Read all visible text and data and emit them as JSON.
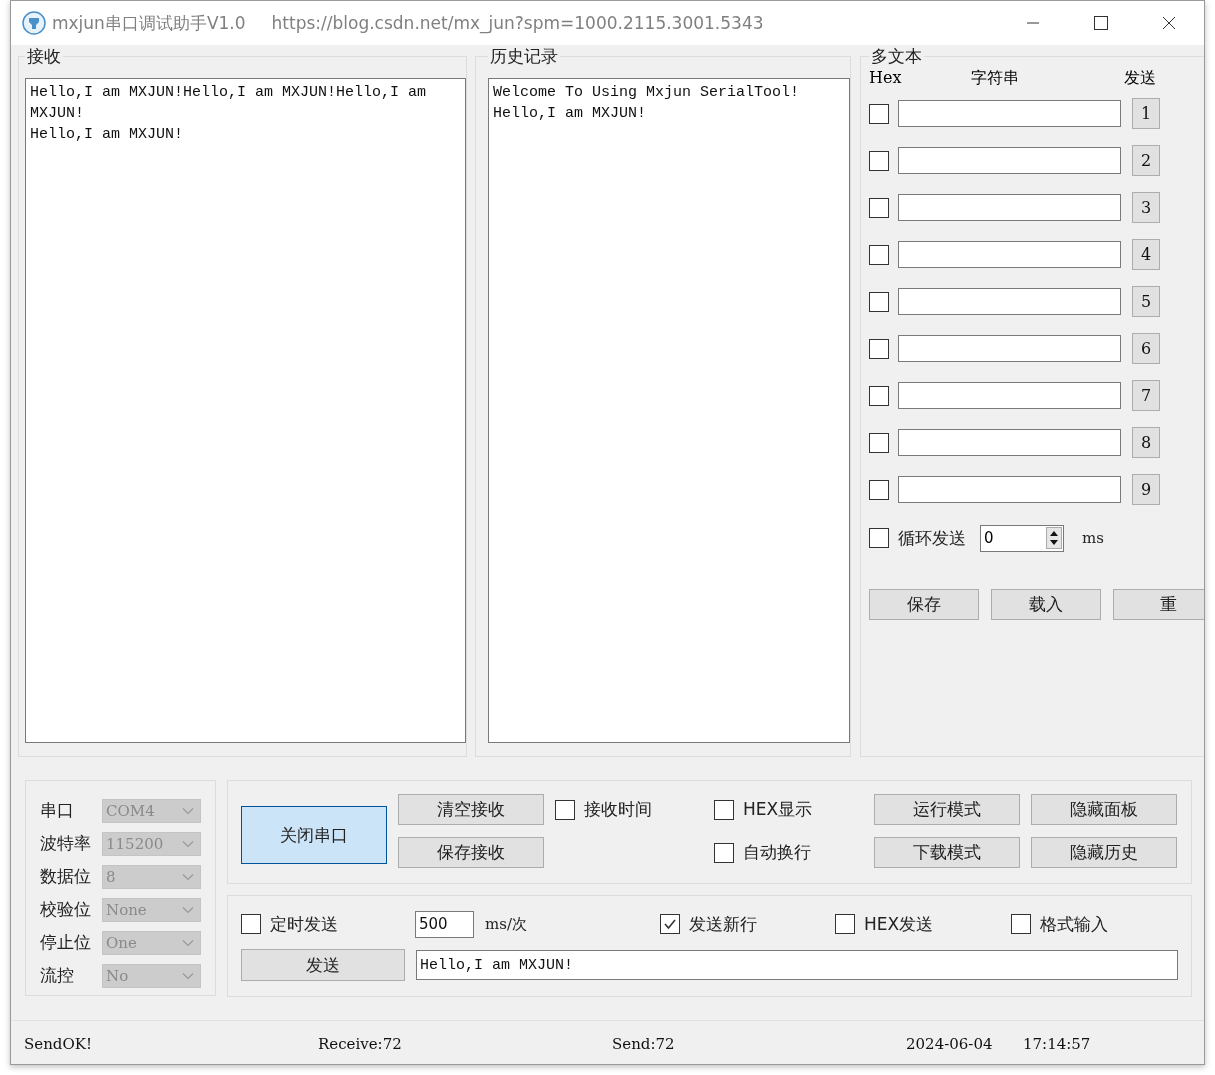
{
  "window": {
    "title": "mxjun串口调试助手V1.0",
    "url": "https://blog.csdn.net/mx_jun?spm=1000.2115.3001.5343"
  },
  "receive": {
    "title": "接收",
    "lines": [
      "Hello,I am MXJUN!Hello,I am MXJUN!Hello,I am",
      "MXJUN!",
      "Hello,I am MXJUN!"
    ]
  },
  "history": {
    "title": "历史记录",
    "lines": [
      "Welcome To Using Mxjun SerialTool!",
      "Hello,I am MXJUN!"
    ]
  },
  "multi_text": {
    "title": "多文本",
    "headers": {
      "hex": "Hex",
      "string": "字符串",
      "send": "发送"
    },
    "rows": [
      {
        "hex": false,
        "button": "1"
      },
      {
        "hex": false,
        "button": "2"
      },
      {
        "hex": false,
        "button": "3"
      },
      {
        "hex": false,
        "button": "4"
      },
      {
        "hex": false,
        "button": "5"
      },
      {
        "hex": false,
        "button": "6"
      },
      {
        "hex": false,
        "button": "7"
      },
      {
        "hex": false,
        "button": "8"
      },
      {
        "hex": false,
        "button": "9"
      }
    ],
    "loop": {
      "label": "循环发送",
      "checked": false,
      "value": "0",
      "unit": "ms"
    },
    "buttons": [
      "保存",
      "载入",
      "重"
    ]
  },
  "port_settings": [
    {
      "label": "串口",
      "value": "COM4"
    },
    {
      "label": "波特率",
      "value": "115200"
    },
    {
      "label": "数据位",
      "value": "8"
    },
    {
      "label": "校验位",
      "value": "None"
    },
    {
      "label": "停止位",
      "value": "One"
    },
    {
      "label": "流控",
      "value": "No"
    }
  ],
  "receive_controls": {
    "port_button": {
      "label": "关闭串口",
      "active": true
    },
    "buttons": [
      "清空接收",
      "保存接收"
    ],
    "checkboxes": [
      {
        "label": "接收时间",
        "checked": false
      },
      {
        "label": "HEX显示",
        "checked": false
      },
      {
        "label": "自动换行",
        "checked": false
      }
    ],
    "mode_buttons": [
      "运行模式",
      "隐藏面板",
      "下载模式",
      "隐藏历史"
    ]
  },
  "send_controls": {
    "timer": {
      "label": "定时发送",
      "checked": false,
      "value": "500",
      "unit": "ms/次"
    },
    "checkboxes": [
      {
        "label": "发送新行",
        "checked": true
      },
      {
        "label": "HEX发送",
        "checked": false
      },
      {
        "label": "格式输入",
        "checked": false
      }
    ],
    "send_button": "发送",
    "message": "Hello,I am MXJUN!"
  },
  "status_bar": {
    "message": "SendOK!",
    "receive": "Receive:72",
    "send": "Send:72",
    "date": "2024-06-04",
    "time": "17:14:57"
  }
}
